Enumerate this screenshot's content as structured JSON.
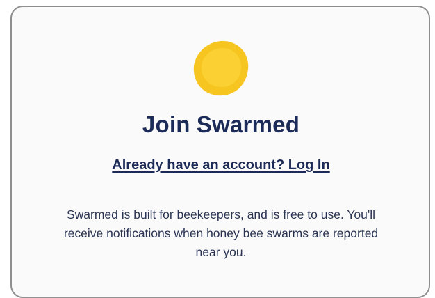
{
  "colors": {
    "accent_yellow": "#f7c51f",
    "text_navy": "#1c2a57",
    "card_border": "#8e8e8e"
  },
  "logo": {
    "icon": "sun-blob-icon"
  },
  "signup": {
    "title": "Join Swarmed",
    "login_link": "Already have an account? Log In",
    "description": "Swarmed is built for beekeepers, and is free to use. You'll receive notifications when honey bee swarms are reported near you."
  }
}
